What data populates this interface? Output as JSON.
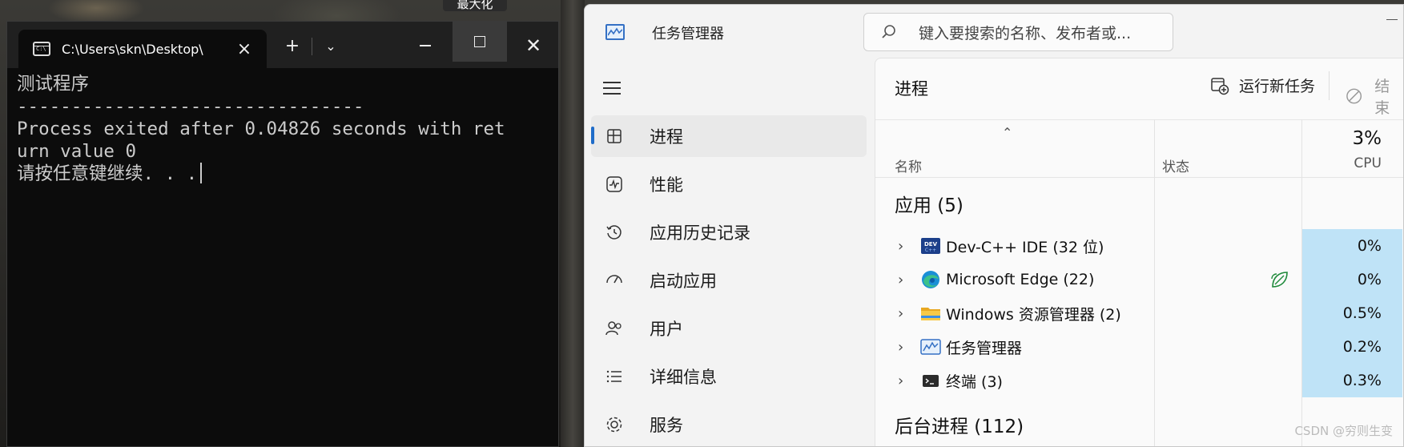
{
  "tooltip": "最大化",
  "terminal": {
    "tab_title": "C:\\Users\\skn\\Desktop\\",
    "new_tab": "+",
    "lines": [
      "测试程序",
      "--------------------------------",
      "Process exited after 0.04826 seconds with ret",
      "urn value 0",
      "请按任意键继续. . ."
    ]
  },
  "taskmgr": {
    "title": "任务管理器",
    "search_placeholder": "键入要搜索的名称、发布者或...",
    "nav": [
      {
        "label": "进程",
        "icon": "processes-icon",
        "active": true
      },
      {
        "label": "性能",
        "icon": "performance-icon",
        "active": false
      },
      {
        "label": "应用历史记录",
        "icon": "history-icon",
        "active": false
      },
      {
        "label": "启动应用",
        "icon": "startup-icon",
        "active": false
      },
      {
        "label": "用户",
        "icon": "users-icon",
        "active": false
      },
      {
        "label": "详细信息",
        "icon": "details-icon",
        "active": false
      },
      {
        "label": "服务",
        "icon": "services-icon",
        "active": false
      }
    ],
    "page_title": "进程",
    "toolbar": {
      "run_new_task": "运行新任务",
      "end_task": "结束"
    },
    "columns": {
      "name": "名称",
      "status": "状态",
      "cpu_total": "3%",
      "cpu": "CPU"
    },
    "groups": {
      "apps": "应用 (5)",
      "background": "后台进程 (112)"
    },
    "apps": [
      {
        "name": "Dev-C++ IDE (32 位)",
        "icon": "devcpp-icon",
        "cpu": "0%",
        "eco": false
      },
      {
        "name": "Microsoft Edge (22)",
        "icon": "edge-icon",
        "cpu": "0%",
        "eco": true
      },
      {
        "name": "Windows 资源管理器 (2)",
        "icon": "folder-icon",
        "cpu": "0.5%",
        "eco": false
      },
      {
        "name": "任务管理器",
        "icon": "taskmgr-icon",
        "cpu": "0.2%",
        "eco": false
      },
      {
        "name": "终端 (3)",
        "icon": "terminal-icon",
        "cpu": "0.3%",
        "eco": false
      }
    ]
  },
  "watermark": "CSDN @穷则生变"
}
